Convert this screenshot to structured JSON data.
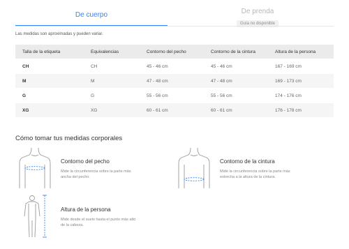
{
  "tabs": {
    "body": "De cuerpo",
    "garment": "De prenda",
    "garment_badge": "Guía no disponible"
  },
  "note": "Las medidas son aproximadas y pueden variar.",
  "table": {
    "headers": [
      "Talla de la etiqueta",
      "Equivalencias",
      "Contorno del pecho",
      "Contorno de la cintura",
      "Altura de la persona"
    ],
    "rows": [
      [
        "CH",
        "CH",
        "45 - 46 cm",
        "45 - 46 cm",
        "167 - 169 cm"
      ],
      [
        "M",
        "M",
        "47 - 48 cm",
        "47 - 48 cm",
        "169 - 173 cm"
      ],
      [
        "G",
        "G",
        "55 - 56 cm",
        "55 - 56 cm",
        "174 - 176 cm"
      ],
      [
        "XG",
        "XG",
        "60 - 61 cm",
        "60 - 61 cm",
        "176 - 178 cm"
      ]
    ]
  },
  "how_to": {
    "title": "Cómo tomar tus medidas corporales",
    "chest": {
      "title": "Contorno del pecho",
      "desc": "Mide la circunferencia sobre la parte más ancha del pecho."
    },
    "waist": {
      "title": "Contorno de la cintura",
      "desc": "Mide la circunferencia sobre la parte más estrecha a la altura de la cintura."
    },
    "height": {
      "title": "Altura de la persona",
      "desc": "Mide desde el suelo hasta el punto más alto de la cabeza."
    }
  },
  "colors": {
    "accent": "#3483fa",
    "header_bg": "#ebebeb",
    "stripe_bg": "#f5f5f5"
  }
}
